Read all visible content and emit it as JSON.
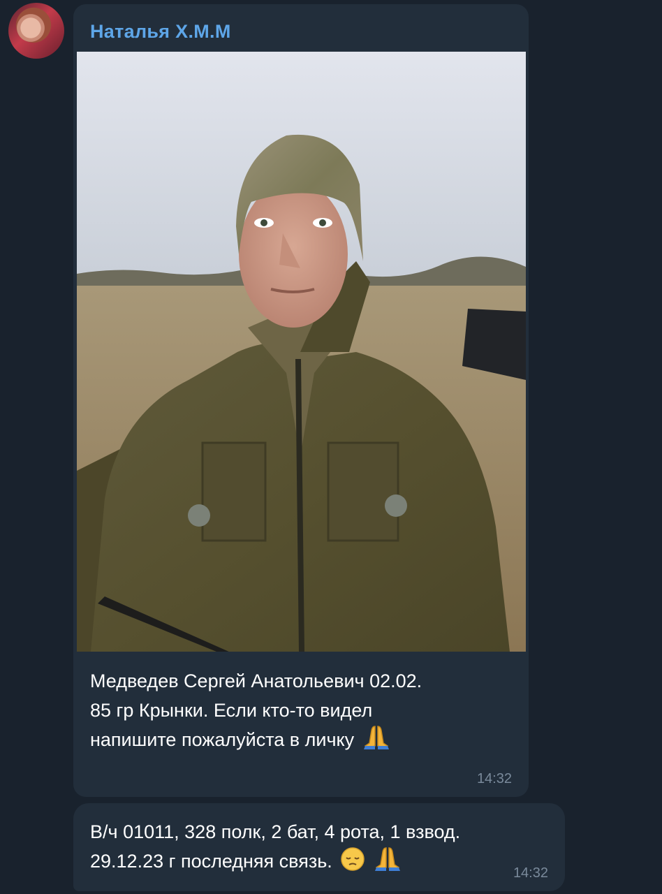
{
  "sender": {
    "name": "Наталья Х.М.М"
  },
  "message1": {
    "text_line1": "Медведев Сергей Анатольевич 02.02.",
    "text_line2": "85 гр Крынки. Если кто-то видел",
    "text_line3": "напишите пожалуйста в личку",
    "time": "14:32"
  },
  "message2": {
    "text_line1": "В/ч 01011, 328 полк, 2 бат, 4 рота, 1 взвод.",
    "text_line2": "29.12.23 г последняя связь.",
    "time": "14:32"
  },
  "icons": {
    "pray": "folded-hands-emoji",
    "pensive": "pensive-face-emoji"
  },
  "colors": {
    "background": "#19222d",
    "bubble": "#222e3b",
    "sender": "#5ea6e8",
    "text": "#ffffff",
    "time": "#7a8a9b"
  }
}
